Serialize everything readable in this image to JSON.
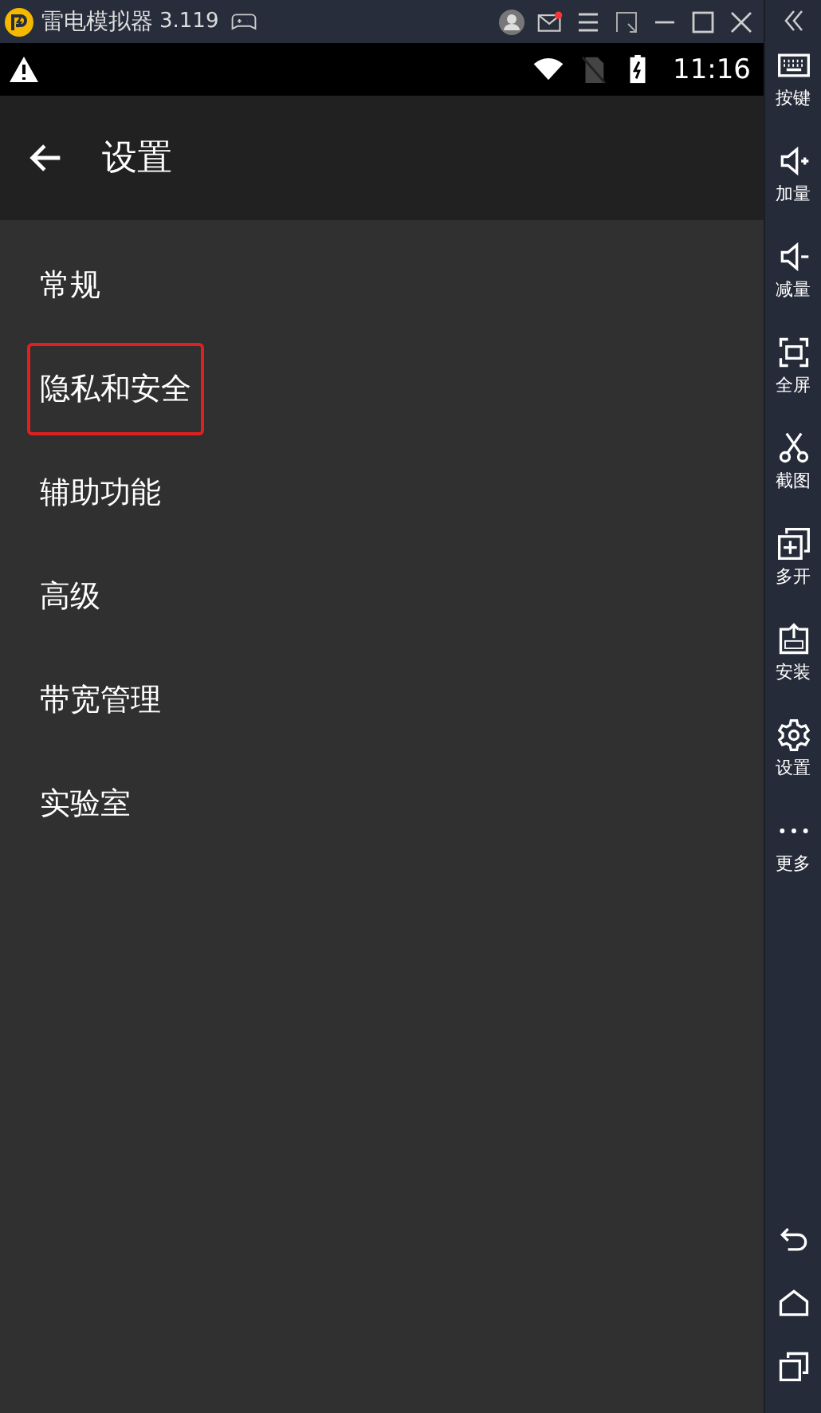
{
  "window": {
    "title": "雷电模拟器",
    "version": "3.119",
    "notification": true
  },
  "status_bar": {
    "time": "11:16"
  },
  "toolbar": {
    "title": "设置"
  },
  "settings": [
    {
      "label": "常规",
      "highlighted": false
    },
    {
      "label": "隐私和安全",
      "highlighted": true
    },
    {
      "label": "辅助功能",
      "highlighted": false
    },
    {
      "label": "高级",
      "highlighted": false
    },
    {
      "label": "带宽管理",
      "highlighted": false
    },
    {
      "label": "实验室",
      "highlighted": false
    }
  ],
  "sidebar": [
    {
      "kind": "keyboard",
      "label": "按键"
    },
    {
      "kind": "volume-up",
      "label": "加量"
    },
    {
      "kind": "volume-down",
      "label": "减量"
    },
    {
      "kind": "fullscreen",
      "label": "全屏"
    },
    {
      "kind": "scissors",
      "label": "截图"
    },
    {
      "kind": "multi",
      "label": "多开"
    },
    {
      "kind": "install",
      "label": "安装"
    },
    {
      "kind": "settings",
      "label": "设置"
    },
    {
      "kind": "more",
      "label": "更多"
    }
  ]
}
